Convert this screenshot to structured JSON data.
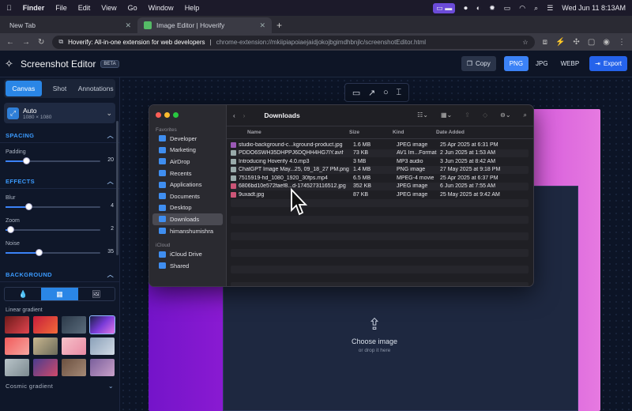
{
  "menubar": {
    "app": "Finder",
    "items": [
      "File",
      "Edit",
      "View",
      "Go",
      "Window",
      "Help"
    ],
    "datetime": "Wed Jun 11  8:13AM"
  },
  "browser": {
    "tabs": [
      {
        "label": "New Tab",
        "active": false
      },
      {
        "label": "Image Editor | Hoverify",
        "active": true
      }
    ],
    "url_ext_name": "Hoverify: All-in-one extension for web developers",
    "url_path": "chrome-extension://mkiipiapoiaejaidjokojbgimdhbnjlc/screenshotEditor.html"
  },
  "app": {
    "title": "Screenshot Editor",
    "badge": "BETA",
    "copy_label": "Copy",
    "formats": [
      "PNG",
      "JPG",
      "WEBP"
    ],
    "active_format": "PNG",
    "export_label": "Export"
  },
  "sidebar": {
    "tabs": [
      "Canvas",
      "Shot",
      "Annotations"
    ],
    "active_tab": "Canvas",
    "preset": {
      "title": "Auto",
      "size": "1080 × 1080"
    },
    "spacing": {
      "heading": "SPACING",
      "padding": {
        "label": "Padding",
        "value": 20,
        "fraction": 0.22
      }
    },
    "effects": {
      "heading": "EFFECTS",
      "blur": {
        "label": "Blur",
        "value": 4,
        "fraction": 0.24
      },
      "zoom": {
        "label": "Zoom",
        "value": 2,
        "fraction": 0.05
      },
      "noise": {
        "label": "Noise",
        "value": 35,
        "fraction": 0.35
      }
    },
    "background": {
      "heading": "BACKGROUND",
      "linear_gradient_label": "Linear gradient",
      "cosmic_gradient_label": "Cosmic gradient"
    }
  },
  "canvas": {
    "upload_title": "Choose image",
    "upload_sub": "or drop it here"
  },
  "finder": {
    "title": "Downloads",
    "sidebar_heading": "Favorites",
    "sidebar_items": [
      "Developer",
      "Marketing",
      "AirDrop",
      "Recents",
      "Applications",
      "Documents",
      "Desktop",
      "Downloads",
      "himanshumishra"
    ],
    "icloud_heading": "iCloud",
    "icloud_items": [
      "iCloud Drive",
      "Shared"
    ],
    "columns": {
      "name": "Name",
      "size": "Size",
      "kind": "Kind",
      "date": "Date Added"
    },
    "files": [
      {
        "name": "studio-background-c...kground-product.jpg",
        "size": "1.6 MB",
        "kind": "JPEG image",
        "date": "25 Apr 2025 at 6:31 PM"
      },
      {
        "name": "PDDO6SWH35DHPPJ6DQHH4HG7IY.avif",
        "size": "73 KB",
        "kind": "AV1 Im...Format",
        "date": "2 Jun 2025 at 1:53 AM"
      },
      {
        "name": "Introducing Hoverify 4.0.mp3",
        "size": "3 MB",
        "kind": "MP3 audio",
        "date": "3 Jun 2025 at 8:42 AM"
      },
      {
        "name": "ChatGPT Image May...25, 09_18_27 PM.png",
        "size": "1.4 MB",
        "kind": "PNG image",
        "date": "27 May 2025 at 9:18 PM"
      },
      {
        "name": "7515919-hd_1080_1920_30fps.mp4",
        "size": "6.5 MB",
        "kind": "MPEG-4 movie",
        "date": "25 Apr 2025 at 6:37 PM"
      },
      {
        "name": "6806bd10e572faef8...d-1745273116512.jpg",
        "size": "352 KB",
        "kind": "JPEG image",
        "date": "6 Jun 2025 at 7:55 AM"
      },
      {
        "name": "9uxadt.jpg",
        "size": "87 KB",
        "kind": "JPEG image",
        "date": "25 May 2025 at 9:42 AM"
      }
    ]
  }
}
